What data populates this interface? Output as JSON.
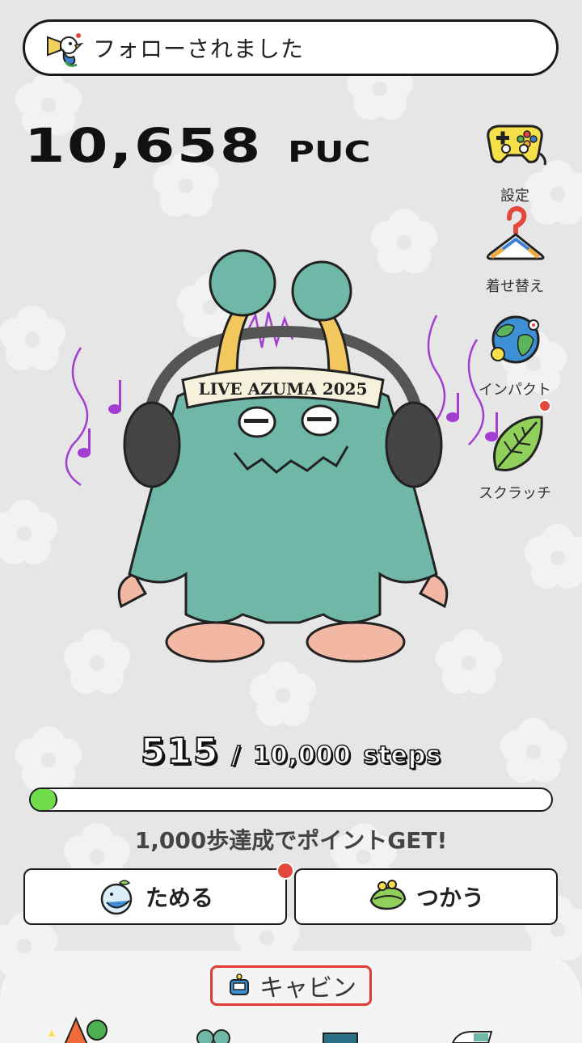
{
  "notification": {
    "text": "フォローされました",
    "icon": "megaphone-bird-icon"
  },
  "points": {
    "value": "10,658",
    "unit": "PUC"
  },
  "side_menu": [
    {
      "label": "設定",
      "icon": "game-controller-icon"
    },
    {
      "label": "着せ替え",
      "icon": "hanger-icon"
    },
    {
      "label": "インパクト",
      "icon": "earth-icon"
    },
    {
      "label": "スクラッチ",
      "icon": "leaf-icon",
      "badge": true
    }
  ],
  "character": {
    "headband_text": "LIVE AZUMA 2025"
  },
  "steps": {
    "current": "515",
    "separator": "/",
    "goal": "10,000",
    "unit": "steps",
    "progress_fraction": 0.0515
  },
  "goal_message": "1,000歩達成でポイントGET!",
  "buttons": {
    "save_label": "ためる",
    "use_label": "つかう"
  },
  "cabin": {
    "label": "キャビン"
  },
  "colors": {
    "background": "#e6e6e6",
    "progress_fill": "#6fdc4c",
    "badge": "#e2483d",
    "cabin_highlight": "#e03b33",
    "monster_fur": "#6fb8a8"
  }
}
